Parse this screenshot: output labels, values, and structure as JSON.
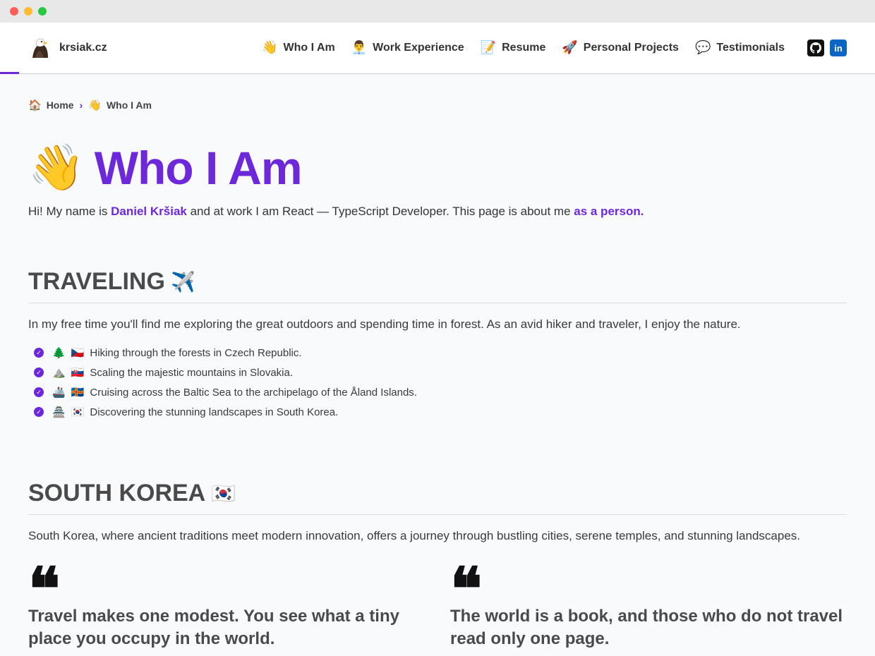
{
  "header": {
    "brand": {
      "logo": "eagle-icon",
      "name": "krsiak.cz"
    },
    "nav": [
      {
        "emoji": "👋",
        "label": "Who I Am",
        "icon": "waving-hand-icon"
      },
      {
        "emoji": "👨‍💼",
        "label": "Work Experience",
        "icon": "office-worker-icon"
      },
      {
        "emoji": "📝",
        "label": "Resume",
        "icon": "memo-icon"
      },
      {
        "emoji": "🚀",
        "label": "Personal Projects",
        "icon": "rocket-icon"
      },
      {
        "emoji": "💬",
        "label": "Testimonials",
        "icon": "speech-bubble-icon"
      }
    ],
    "social": [
      {
        "name": "github",
        "glyph": "●",
        "icon": "github-icon"
      },
      {
        "name": "linkedin",
        "glyph": "in",
        "icon": "linkedin-icon"
      }
    ],
    "accent_color": "#6d28d9"
  },
  "breadcrumb": {
    "home": {
      "emoji": "🏠",
      "label": "Home"
    },
    "separator": "›",
    "current": {
      "emoji": "👋",
      "label": "Who I Am"
    }
  },
  "page": {
    "title_emoji": "👋",
    "title": "Who I Am",
    "intro_prefix": "Hi! My name is ",
    "intro_name": "Daniel Kršiak",
    "intro_middle": " and at work I am React — TypeScript Developer. This page is about me ",
    "intro_link": "as a person."
  },
  "traveling": {
    "title": "TRAVELING",
    "emoji": "✈️",
    "text": "In my free time you'll find me exploring the great outdoors and spending time in forest. As an avid hiker and traveler, I enjoy the nature.",
    "items": [
      {
        "emoji1": "🌲",
        "emoji2": "🇨🇿",
        "text": "Hiking through the forests in Czech Republic."
      },
      {
        "emoji1": "⛰️",
        "emoji2": "🇸🇰",
        "text": "Scaling the majestic mountains in Slovakia."
      },
      {
        "emoji1": "🚢",
        "emoji2": "🇦🇽",
        "text": "Cruising across the Baltic Sea to the archipelago of the Åland Islands."
      },
      {
        "emoji1": "🏯",
        "emoji2": "🇰🇷",
        "text": "Discovering the stunning landscapes in South Korea."
      }
    ]
  },
  "south_korea": {
    "title": "SOUTH KOREA",
    "emoji": "🇰🇷",
    "text": "South Korea, where ancient traditions meet modern innovation, offers a journey through bustling cities, serene temples, and stunning landscapes.",
    "quotes": [
      {
        "mark": "❝",
        "text": "Travel makes one modest. You see what a tiny place you occupy in the world."
      },
      {
        "mark": "❝",
        "text": "The world is a book, and those who do not travel read only one page."
      }
    ]
  }
}
